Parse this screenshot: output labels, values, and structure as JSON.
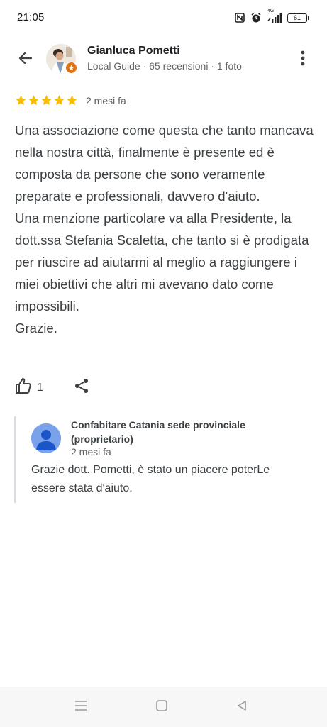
{
  "status_bar": {
    "time": "21:05",
    "battery_level": "61",
    "network_label": "4G"
  },
  "header": {
    "reviewer_name": "Gianluca Pometti",
    "reviewer_meta": "Local Guide · 65 recensioni · 1 foto"
  },
  "review": {
    "rating": 5,
    "star_color": "#fbbc04",
    "date": "2 mesi fa",
    "text": "Una associazione come questa che tanto mancava nella nostra città, finalmente è presente ed è composta da persone che sono veramente preparate e professionali, davvero d'aiuto.\nUna menzione particolare va alla Presidente, la dott.ssa Stefania Scaletta, che tanto si è prodigata per riuscire ad aiutarmi al meglio a raggiungere i miei obiettivi che altri mi avevano dato come impossibili.\nGrazie."
  },
  "actions": {
    "like_count": "1"
  },
  "reply": {
    "owner_name": "Confabitare Catania sede provinciale",
    "owner_role": "(proprietario)",
    "date": "2 mesi fa",
    "text": "Grazie dott. Pometti, è stato un piacere poterLe essere stata d'aiuto."
  },
  "icons": {
    "back": "arrow-left-icon",
    "more": "more-vert-icon",
    "like": "thumb-up-icon",
    "share": "share-icon",
    "nav_menu": "menu-icon",
    "nav_home": "home-square-icon",
    "nav_back": "back-triangle-icon"
  }
}
